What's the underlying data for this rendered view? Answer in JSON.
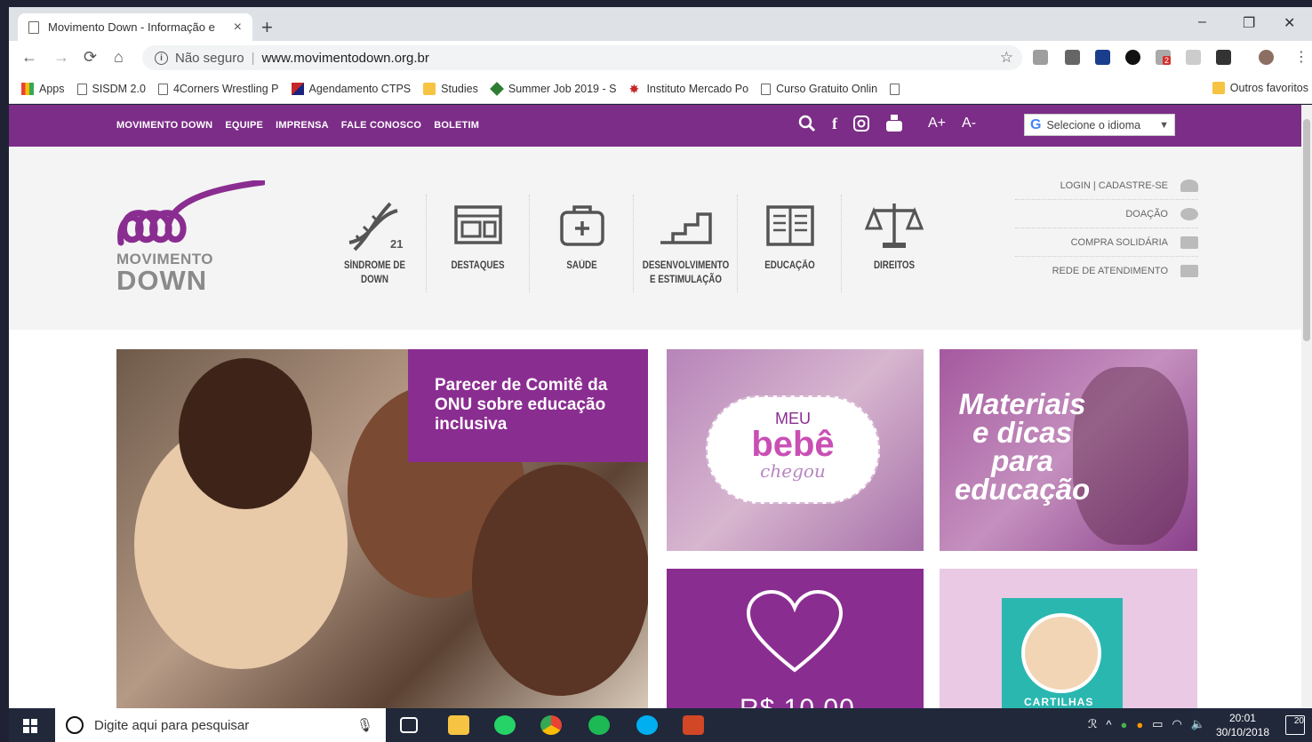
{
  "browser": {
    "tab_title": "Movimento Down - Informação e",
    "tab_close": "×",
    "new_tab": "+",
    "security_label": "Não seguro",
    "url": "www.movimentodown.org.br",
    "window_controls": {
      "minimize": "–",
      "maximize": "❐",
      "close": "✕"
    },
    "bookmarks": [
      {
        "label": "Apps"
      },
      {
        "label": "SISDM 2.0"
      },
      {
        "label": "4Corners Wrestling P"
      },
      {
        "label": "Agendamento CTPS"
      },
      {
        "label": "Studies"
      },
      {
        "label": "Summer Job 2019 - S"
      },
      {
        "label": "Instituto Mercado Po"
      },
      {
        "label": "Curso Gratuito Onlin"
      },
      {
        "label": ""
      }
    ],
    "other_bookmarks": "Outros favoritos",
    "extension_badge": "2"
  },
  "site": {
    "topnav": [
      "MOVIMENTO DOWN",
      "EQUIPE",
      "IMPRENSA",
      "FALE CONOSCO",
      "BOLETIM"
    ],
    "font_plus": "A+",
    "font_minus": "A-",
    "language_select": "Selecione o idioma",
    "logo": {
      "line1": "MOVIMENTO",
      "line2": "DOWN"
    },
    "categories": [
      {
        "label": "SÍNDROME DE DOWN",
        "icon": "dna-icon"
      },
      {
        "label": "DESTAQUES",
        "icon": "browser-window-icon"
      },
      {
        "label": "SAÚDE",
        "icon": "first-aid-kit-icon"
      },
      {
        "label": "DESENVOLVIMENTO E ESTIMULAÇÃO",
        "icon": "stairs-icon"
      },
      {
        "label": "EDUCAÇÃO",
        "icon": "open-book-icon"
      },
      {
        "label": "DIREITOS",
        "icon": "scales-icon"
      }
    ],
    "dna_number": "21",
    "side_links": [
      {
        "label": "LOGIN | CADASTRE-SE",
        "icon": "user-icon"
      },
      {
        "label": "DOAÇÃO",
        "icon": "heart-icon"
      },
      {
        "label": "COMPRA SOLIDÁRIA",
        "icon": "cart-icon"
      },
      {
        "label": "REDE DE ATENDIMENTO",
        "icon": "briefcase-icon"
      }
    ],
    "hero_caption": "Parecer de Comitê da ONU sobre educação inclusiva",
    "bebe_card": {
      "meu": "MEU",
      "bebe": "bebê",
      "chegou": "chegou"
    },
    "materiais_text": "Materiais e dicas para educação",
    "donate_price": "R$ 10,00",
    "cartilhas_text": "CARTILHAS"
  },
  "taskbar": {
    "search_placeholder": "Digite aqui para pesquisar",
    "time": "20:01",
    "date": "30/10/2018",
    "notification_count": "20"
  },
  "colors": {
    "brand_purple": "#7b2d87",
    "caption_purple": "#8a2d91",
    "taskbar": "#20283a"
  }
}
